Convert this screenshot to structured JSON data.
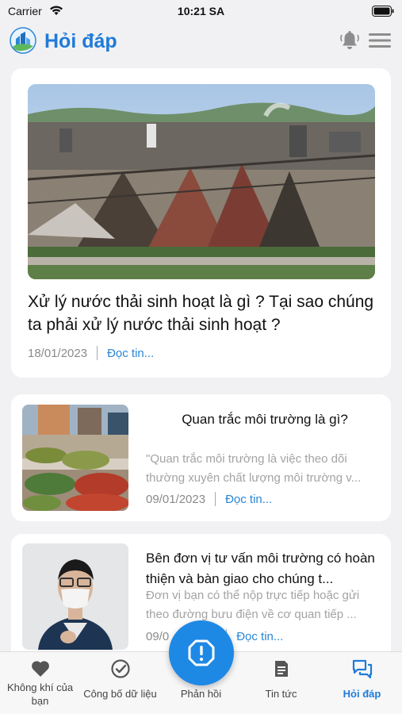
{
  "status_bar": {
    "carrier": "Carrier",
    "time": "10:21 SA"
  },
  "header": {
    "title": "Hỏi đáp",
    "icons": [
      "app-logo",
      "bell-icon",
      "menu-icon"
    ]
  },
  "featured": {
    "title": "Xử lý nước thải sinh hoạt là gì ? Tại sao chúng ta phải xử lý nước thải sinh hoạt ?",
    "date": "18/01/2023",
    "read_more": "Đọc tin..."
  },
  "articles": [
    {
      "title": "Quan trắc môi trường là gì?",
      "excerpt": "\"Quan trắc môi trường là việc theo dõi thường xuyên chất lượng môi trường v...",
      "date": "09/01/2023",
      "read_more": "Đọc tin..."
    },
    {
      "title": "Bên đơn vị tư vấn môi trường có hoàn thiện và bàn giao cho chúng t...",
      "excerpt": "Đơn vị bạn có thể nộp trực tiếp hoặc gửi theo đường bưu điện về cơ quan tiếp ...",
      "date": "09/0",
      "read_more": "Đọc tin..."
    }
  ],
  "tabs": [
    {
      "label": "Không khí của bạn",
      "icon": "heart-icon"
    },
    {
      "label": "Công bố dữ liệu",
      "icon": "check-circle-icon"
    },
    {
      "label": "Phản hồi",
      "icon": "alert-icon"
    },
    {
      "label": "Tin tức",
      "icon": "news-icon"
    },
    {
      "label": "Hỏi đáp",
      "icon": "chat-icon",
      "active": true
    }
  ],
  "colors": {
    "accent": "#1f7bd8",
    "fab": "#1e88e5",
    "link": "#2b87d6"
  }
}
